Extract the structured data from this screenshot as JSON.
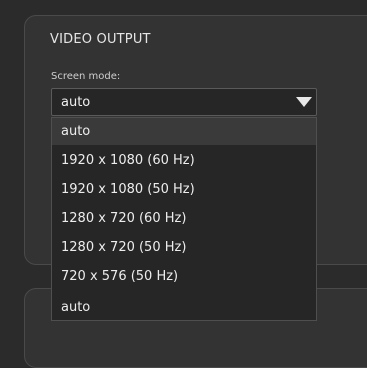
{
  "section": {
    "title": "VIDEO OUTPUT"
  },
  "screen_mode": {
    "label": "Screen mode:",
    "selected_value": "auto",
    "dropdown_icon": "chevron-down-icon",
    "options": [
      "auto",
      "1920 x 1080 (60 Hz)",
      "1920 x 1080 (50 Hz)",
      "1280 x 720 (60 Hz)",
      "1280 x 720 (50 Hz)",
      "720 x 576 (50 Hz)",
      "auto"
    ]
  },
  "colors": {
    "background": "#2b2b2b",
    "panel": "#333333",
    "dropdown": "#262626",
    "text": "#ededed",
    "highlight": "#3a3a3a"
  }
}
